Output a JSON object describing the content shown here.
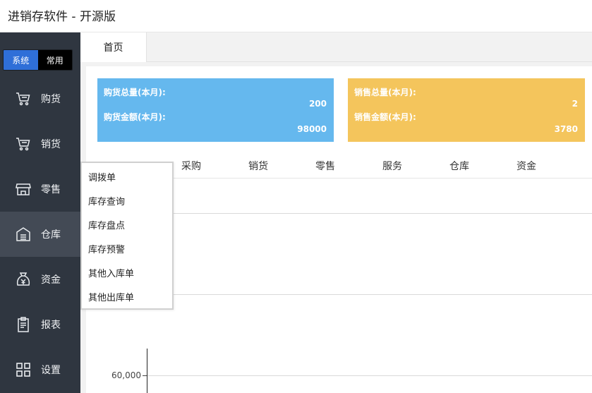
{
  "app": {
    "title": "进销存软件 - 开源版"
  },
  "sidebar": {
    "switch": {
      "system": "系统",
      "common": "常用"
    },
    "items": [
      {
        "label": "购货",
        "icon": "cart-icon"
      },
      {
        "label": "销货",
        "icon": "cart-icon"
      },
      {
        "label": "零售",
        "icon": "store-icon"
      },
      {
        "label": "仓库",
        "icon": "warehouse-icon"
      },
      {
        "label": "资金",
        "icon": "money-bag-icon"
      },
      {
        "label": "报表",
        "icon": "clipboard-icon"
      },
      {
        "label": "设置",
        "icon": "grid-icon"
      }
    ],
    "selected": "仓库"
  },
  "tabs": {
    "home": "首页"
  },
  "cards": {
    "purchase": {
      "qty_label": "购货总量(本月):",
      "qty_value": "200",
      "amount_label": "购货金额(本月):",
      "amount_value": "98000",
      "color": "#65b8ee"
    },
    "sales": {
      "qty_label": "销售总量(本月):",
      "qty_value": "2",
      "amount_label": "销售金额(本月):",
      "amount_value": "3780",
      "color": "#f4c55c"
    }
  },
  "chart_tabs": [
    "采购",
    "销货",
    "零售",
    "服务",
    "仓库",
    "资金"
  ],
  "chart": {
    "y_tick": "60,000"
  },
  "dropdown": {
    "items": [
      "调拨单",
      "库存查询",
      "库存盘点",
      "库存预警",
      "其他入库单",
      "其他出库单"
    ]
  }
}
